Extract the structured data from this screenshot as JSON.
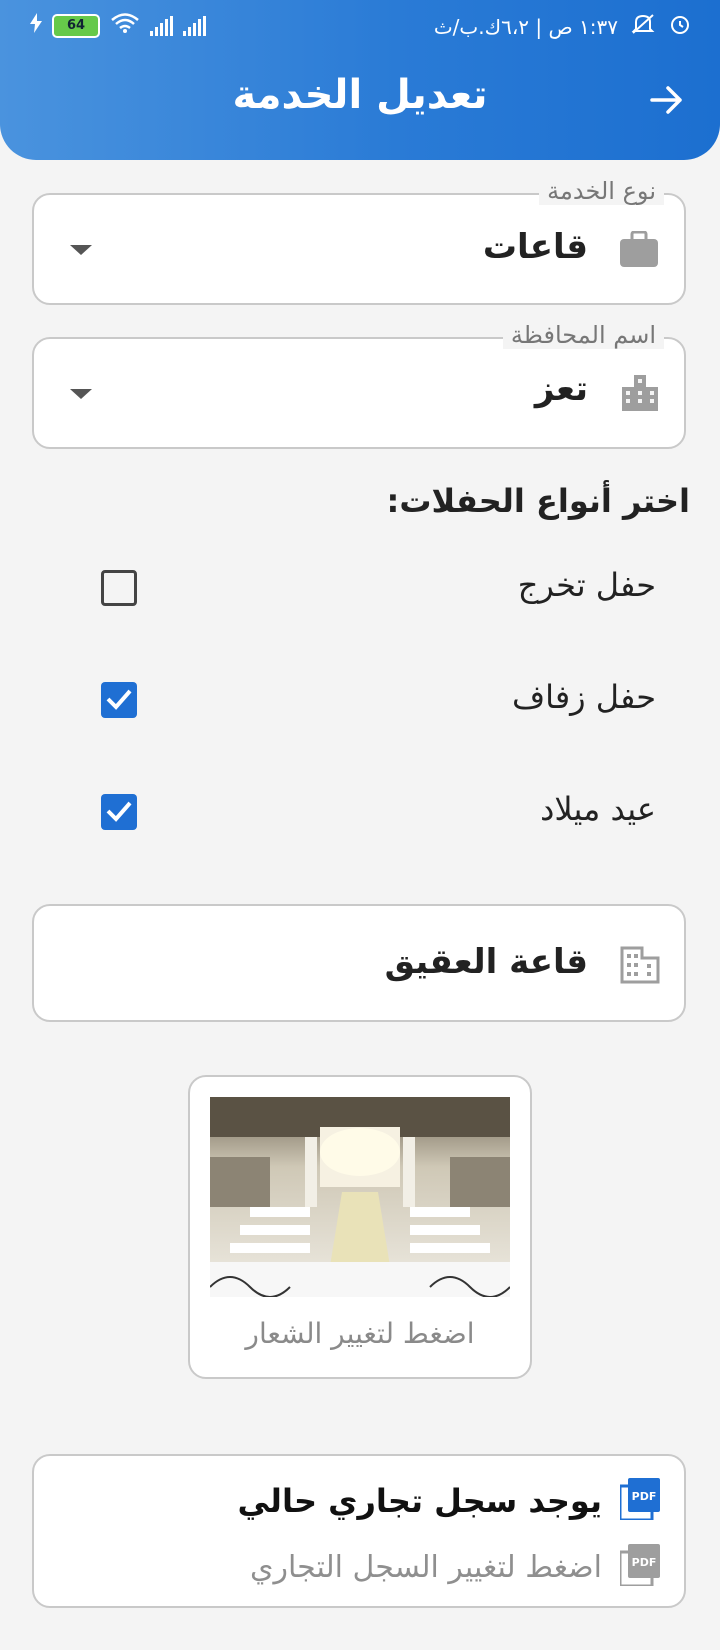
{
  "status_bar": {
    "time_info": "١:٣٧ ص | ٦،٢ك.ب/ث",
    "battery": "64"
  },
  "header": {
    "title": "تعديل الخدمة"
  },
  "service_type": {
    "legend": "نوع الخدمة",
    "value": "قاعات"
  },
  "governorate": {
    "legend": "اسم المحافظة",
    "value": "تعز"
  },
  "events": {
    "label": "اختر أنواع الحفلات:",
    "options": [
      {
        "label": "حفل تخرج",
        "checked": false
      },
      {
        "label": "حفل زفاف",
        "checked": true
      },
      {
        "label": "عيد ميلاد",
        "checked": true
      }
    ]
  },
  "hall_name": {
    "value": "قاعة العقيق"
  },
  "logo": {
    "caption": "اضغط لتغيير الشعار"
  },
  "commercial_register": {
    "status": "يوجد سجل تجاري حالي",
    "action": "اضغط لتغيير السجل التجاري"
  },
  "colors": {
    "header": "#2a7bd6",
    "accent": "#1f6fd3"
  }
}
